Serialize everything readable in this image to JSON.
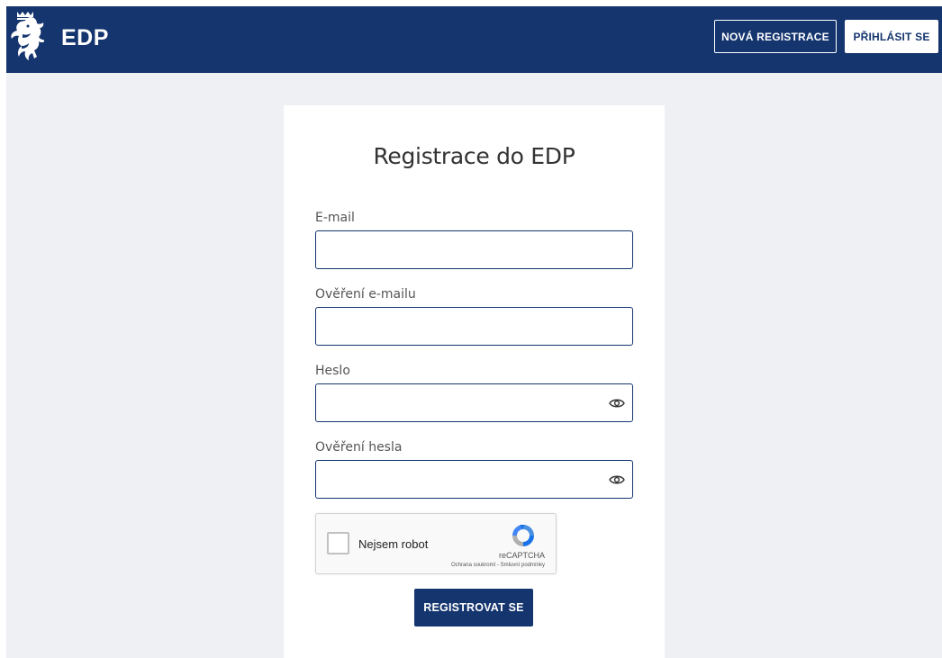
{
  "header": {
    "brand": "EDP",
    "new_registration_label": "NOVÁ REGISTRACE",
    "login_label": "PŘIHLÁSIT SE"
  },
  "form": {
    "title": "Registrace do EDP",
    "fields": [
      {
        "label": "E-mail",
        "value": "",
        "type": "email"
      },
      {
        "label": "Ověření e-mailu",
        "value": "",
        "type": "email"
      },
      {
        "label": "Heslo",
        "value": "",
        "type": "password",
        "icon": "eye-icon"
      },
      {
        "label": "Ověření hesla",
        "value": "",
        "type": "password",
        "icon": "eye-icon"
      }
    ],
    "captcha": {
      "label": "Nejsem robot",
      "brand": "reCAPTCHA",
      "terms": "Ochrana soukromí - Smluvní podmínky",
      "checked": false
    },
    "submit_label": "REGISTROVAT SE"
  },
  "colors": {
    "primary": "#15356f",
    "background": "#eef0f4",
    "card": "#ffffff"
  }
}
